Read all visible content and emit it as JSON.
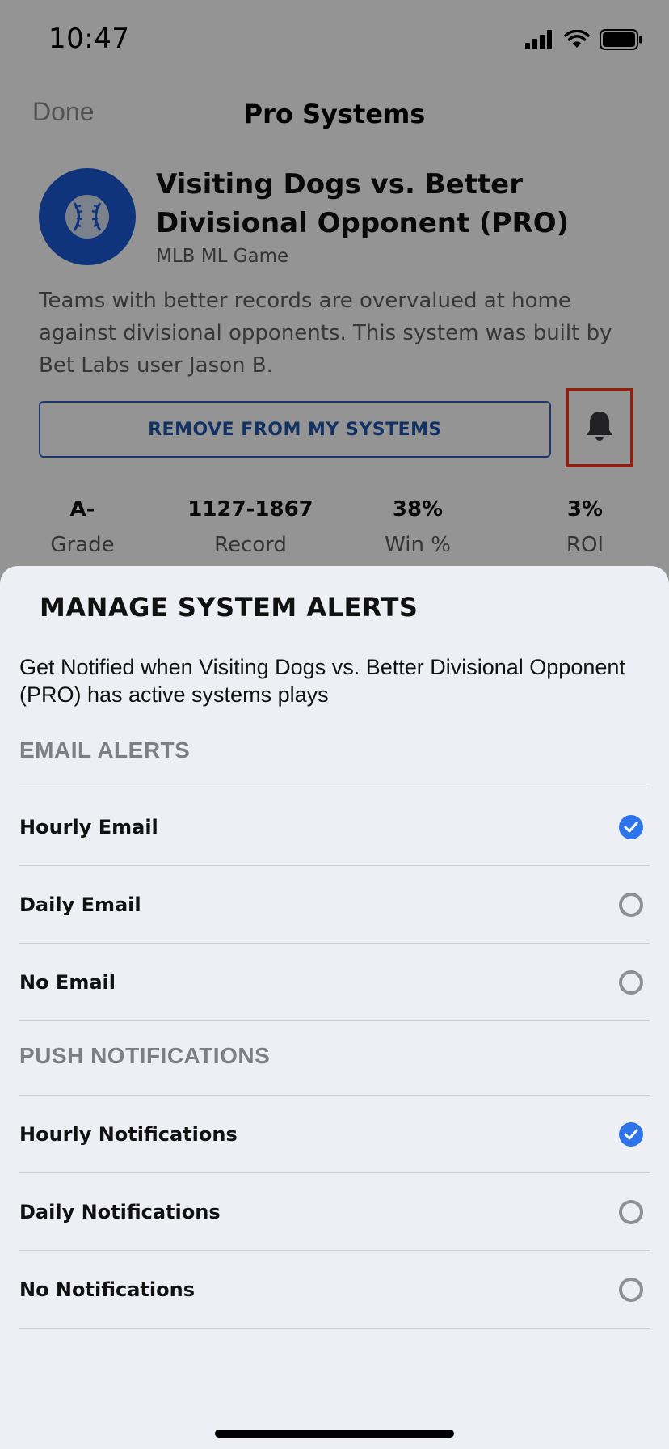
{
  "status_bar": {
    "time": "10:47"
  },
  "nav": {
    "done_label": "Done",
    "title": "Pro Systems"
  },
  "system": {
    "icon": "baseball-icon",
    "title": "Visiting Dogs vs. Better Divisional Opponent (PRO)",
    "subtitle": "MLB ML Game",
    "description": "Teams with better records are overvalued at home against divisional opponents. This system was built by Bet Labs user Jason B.",
    "remove_label": "REMOVE FROM MY SYSTEMS",
    "bell_icon": "bell-icon",
    "highlight_color": "#ee3b22"
  },
  "stats": [
    {
      "value": "A-",
      "label": "Grade"
    },
    {
      "value": "1127-1867",
      "label": "Record"
    },
    {
      "value": "38%",
      "label": "Win %"
    },
    {
      "value": "3%",
      "label": "ROI"
    }
  ],
  "sheet": {
    "title": "MANAGE SYSTEM ALERTS",
    "description": "Get Notified when Visiting Dogs vs. Better Divisional Opponent (PRO) has active systems plays",
    "accent_color": "#2d74ea",
    "email": {
      "header": "EMAIL ALERTS",
      "options": [
        {
          "label": "Hourly Email",
          "selected": true
        },
        {
          "label": "Daily Email",
          "selected": false
        },
        {
          "label": "No Email",
          "selected": false
        }
      ]
    },
    "push": {
      "header": "PUSH NOTIFICATIONS",
      "options": [
        {
          "label": "Hourly Notifications",
          "selected": true
        },
        {
          "label": "Daily Notifications",
          "selected": false
        },
        {
          "label": "No Notifications",
          "selected": false
        }
      ]
    }
  }
}
